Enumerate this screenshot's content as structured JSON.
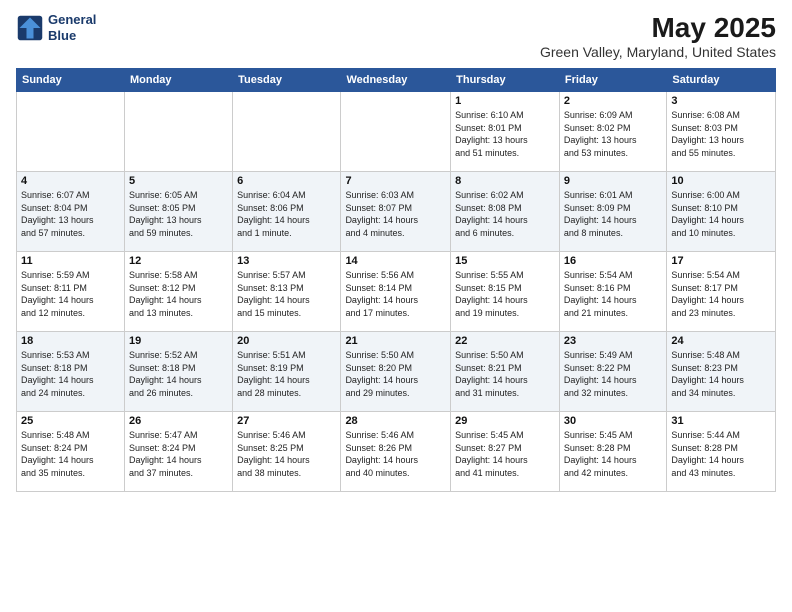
{
  "logo": {
    "line1": "General",
    "line2": "Blue"
  },
  "title": "May 2025",
  "subtitle": "Green Valley, Maryland, United States",
  "days_header": [
    "Sunday",
    "Monday",
    "Tuesday",
    "Wednesday",
    "Thursday",
    "Friday",
    "Saturday"
  ],
  "weeks": [
    [
      {
        "day": "",
        "info": ""
      },
      {
        "day": "",
        "info": ""
      },
      {
        "day": "",
        "info": ""
      },
      {
        "day": "",
        "info": ""
      },
      {
        "day": "1",
        "info": "Sunrise: 6:10 AM\nSunset: 8:01 PM\nDaylight: 13 hours\nand 51 minutes."
      },
      {
        "day": "2",
        "info": "Sunrise: 6:09 AM\nSunset: 8:02 PM\nDaylight: 13 hours\nand 53 minutes."
      },
      {
        "day": "3",
        "info": "Sunrise: 6:08 AM\nSunset: 8:03 PM\nDaylight: 13 hours\nand 55 minutes."
      }
    ],
    [
      {
        "day": "4",
        "info": "Sunrise: 6:07 AM\nSunset: 8:04 PM\nDaylight: 13 hours\nand 57 minutes."
      },
      {
        "day": "5",
        "info": "Sunrise: 6:05 AM\nSunset: 8:05 PM\nDaylight: 13 hours\nand 59 minutes."
      },
      {
        "day": "6",
        "info": "Sunrise: 6:04 AM\nSunset: 8:06 PM\nDaylight: 14 hours\nand 1 minute."
      },
      {
        "day": "7",
        "info": "Sunrise: 6:03 AM\nSunset: 8:07 PM\nDaylight: 14 hours\nand 4 minutes."
      },
      {
        "day": "8",
        "info": "Sunrise: 6:02 AM\nSunset: 8:08 PM\nDaylight: 14 hours\nand 6 minutes."
      },
      {
        "day": "9",
        "info": "Sunrise: 6:01 AM\nSunset: 8:09 PM\nDaylight: 14 hours\nand 8 minutes."
      },
      {
        "day": "10",
        "info": "Sunrise: 6:00 AM\nSunset: 8:10 PM\nDaylight: 14 hours\nand 10 minutes."
      }
    ],
    [
      {
        "day": "11",
        "info": "Sunrise: 5:59 AM\nSunset: 8:11 PM\nDaylight: 14 hours\nand 12 minutes."
      },
      {
        "day": "12",
        "info": "Sunrise: 5:58 AM\nSunset: 8:12 PM\nDaylight: 14 hours\nand 13 minutes."
      },
      {
        "day": "13",
        "info": "Sunrise: 5:57 AM\nSunset: 8:13 PM\nDaylight: 14 hours\nand 15 minutes."
      },
      {
        "day": "14",
        "info": "Sunrise: 5:56 AM\nSunset: 8:14 PM\nDaylight: 14 hours\nand 17 minutes."
      },
      {
        "day": "15",
        "info": "Sunrise: 5:55 AM\nSunset: 8:15 PM\nDaylight: 14 hours\nand 19 minutes."
      },
      {
        "day": "16",
        "info": "Sunrise: 5:54 AM\nSunset: 8:16 PM\nDaylight: 14 hours\nand 21 minutes."
      },
      {
        "day": "17",
        "info": "Sunrise: 5:54 AM\nSunset: 8:17 PM\nDaylight: 14 hours\nand 23 minutes."
      }
    ],
    [
      {
        "day": "18",
        "info": "Sunrise: 5:53 AM\nSunset: 8:18 PM\nDaylight: 14 hours\nand 24 minutes."
      },
      {
        "day": "19",
        "info": "Sunrise: 5:52 AM\nSunset: 8:18 PM\nDaylight: 14 hours\nand 26 minutes."
      },
      {
        "day": "20",
        "info": "Sunrise: 5:51 AM\nSunset: 8:19 PM\nDaylight: 14 hours\nand 28 minutes."
      },
      {
        "day": "21",
        "info": "Sunrise: 5:50 AM\nSunset: 8:20 PM\nDaylight: 14 hours\nand 29 minutes."
      },
      {
        "day": "22",
        "info": "Sunrise: 5:50 AM\nSunset: 8:21 PM\nDaylight: 14 hours\nand 31 minutes."
      },
      {
        "day": "23",
        "info": "Sunrise: 5:49 AM\nSunset: 8:22 PM\nDaylight: 14 hours\nand 32 minutes."
      },
      {
        "day": "24",
        "info": "Sunrise: 5:48 AM\nSunset: 8:23 PM\nDaylight: 14 hours\nand 34 minutes."
      }
    ],
    [
      {
        "day": "25",
        "info": "Sunrise: 5:48 AM\nSunset: 8:24 PM\nDaylight: 14 hours\nand 35 minutes."
      },
      {
        "day": "26",
        "info": "Sunrise: 5:47 AM\nSunset: 8:24 PM\nDaylight: 14 hours\nand 37 minutes."
      },
      {
        "day": "27",
        "info": "Sunrise: 5:46 AM\nSunset: 8:25 PM\nDaylight: 14 hours\nand 38 minutes."
      },
      {
        "day": "28",
        "info": "Sunrise: 5:46 AM\nSunset: 8:26 PM\nDaylight: 14 hours\nand 40 minutes."
      },
      {
        "day": "29",
        "info": "Sunrise: 5:45 AM\nSunset: 8:27 PM\nDaylight: 14 hours\nand 41 minutes."
      },
      {
        "day": "30",
        "info": "Sunrise: 5:45 AM\nSunset: 8:28 PM\nDaylight: 14 hours\nand 42 minutes."
      },
      {
        "day": "31",
        "info": "Sunrise: 5:44 AM\nSunset: 8:28 PM\nDaylight: 14 hours\nand 43 minutes."
      }
    ]
  ]
}
